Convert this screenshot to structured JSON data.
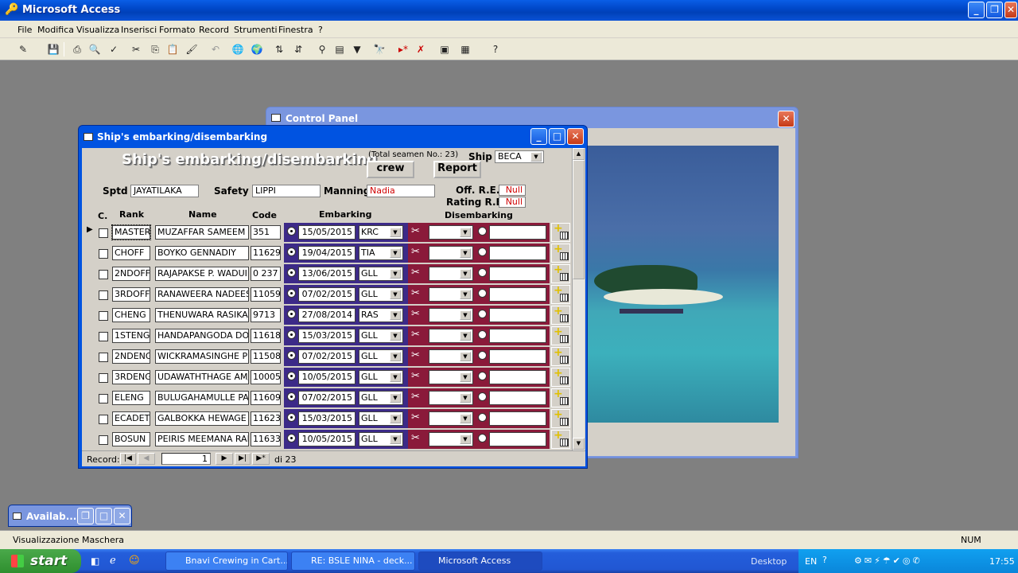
{
  "app": {
    "title": "Microsoft Access"
  },
  "menu": [
    "File",
    "Modifica",
    "Visualizza",
    "Inserisci",
    "Formato",
    "Record",
    "Strumenti",
    "Finestra",
    "?"
  ],
  "control_panel": {
    "title": "Control Panel"
  },
  "form": {
    "window_title": "Ship's embarking/disembarking",
    "heading": "Ship's embarking/disembarking",
    "total_seamen": "(Total seamen No.: 23)",
    "ship_label": "Ship",
    "ship_value": "BECA",
    "crew_button": "crew",
    "report_button": "Report",
    "sptd_label": "Sptd",
    "sptd_value": "JAYATILAKA",
    "safety_label": "Safety",
    "safety_value": "LIPPI",
    "manning_label": "Manning",
    "manning_value": "Nadia",
    "off_re_label": "Off. R.E.",
    "off_re_value": "Null",
    "rating_re_label": "Rating R.E.",
    "rating_re_value": "Null",
    "col_c": "C.",
    "col_rank": "Rank",
    "col_name": "Name",
    "col_code": "Code",
    "col_embarking": "Embarking",
    "col_disembarking": "Disembarking",
    "rows": [
      {
        "rank": "MASTER",
        "name": "MUZAFFAR SAMEEM",
        "code": "351",
        "date": "15/05/2015",
        "port": "KRC"
      },
      {
        "rank": "CHOFF",
        "name": "BOYKO GENNADIY",
        "code": "11629",
        "date": "19/04/2015",
        "port": "TIA"
      },
      {
        "rank": "2NDOFF",
        "name": "RAJAPAKSE P. WADUI",
        "code": "0 237",
        "date": "13/06/2015",
        "port": "GLL"
      },
      {
        "rank": "3RDOFF",
        "name": "RANAWEERA NADEES",
        "code": "11059",
        "date": "07/02/2015",
        "port": "GLL"
      },
      {
        "rank": "CHENG",
        "name": "THENUWARA RASIKA",
        "code": "9713",
        "date": "27/08/2014",
        "port": "RAS"
      },
      {
        "rank": "1STENG",
        "name": "HANDAPANGODA DON",
        "code": "11618",
        "date": "15/03/2015",
        "port": "GLL"
      },
      {
        "rank": "2NDENG",
        "name": "WICKRAMASINGHE PE",
        "code": "11508",
        "date": "07/02/2015",
        "port": "GLL"
      },
      {
        "rank": "3RDENG",
        "name": "UDAWATHTHAGE AM/",
        "code": "10005",
        "date": "10/05/2015",
        "port": "GLL"
      },
      {
        "rank": "ELENG",
        "name": "BULUGAHAMULLE PA",
        "code": "11609",
        "date": "07/02/2015",
        "port": "GLL"
      },
      {
        "rank": "ECADET",
        "name": "GALBOKKA HEWAGE I",
        "code": "11623",
        "date": "15/03/2015",
        "port": "GLL"
      },
      {
        "rank": "BOSUN",
        "name": "PEIRIS MEEMANA RAI",
        "code": "11633",
        "date": "10/05/2015",
        "port": "GLL"
      }
    ],
    "nav": {
      "label": "Record:",
      "current": "1",
      "of": "di 23"
    }
  },
  "avail": {
    "title": "Availab..."
  },
  "status": {
    "text": "Visualizzazione Maschera",
    "num": "NUM"
  },
  "taskbar": {
    "start": "start",
    "tasks": [
      "Bnavi Crewing in Cart...",
      "RE: BSLE NINA - deck...",
      "Microsoft Access"
    ],
    "desktop": "Desktop",
    "lang": "EN",
    "clock": "17:55"
  }
}
